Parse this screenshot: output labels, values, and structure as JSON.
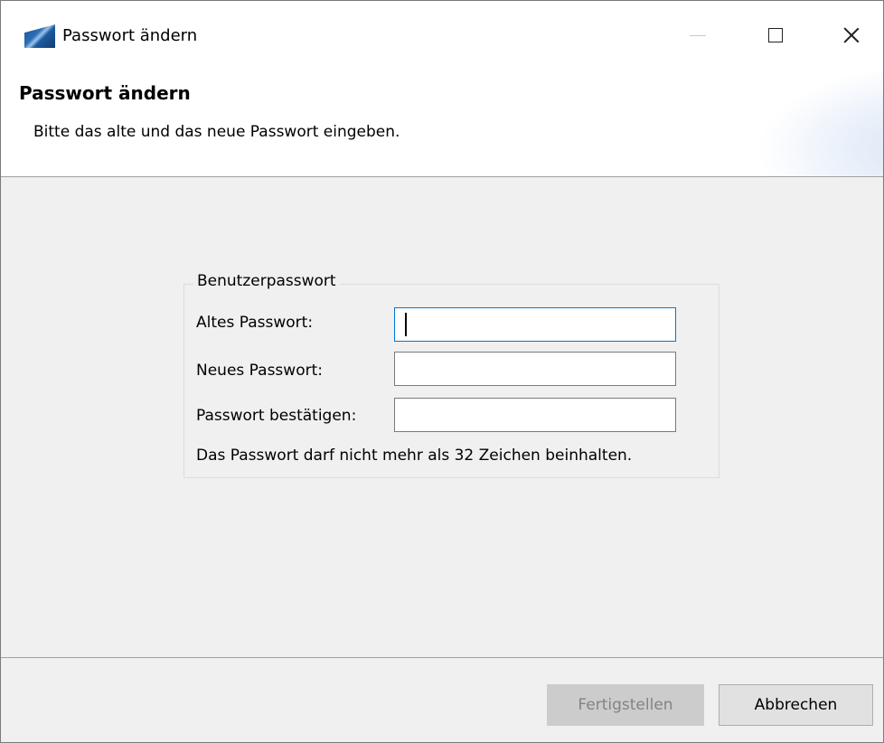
{
  "window": {
    "title": "Passwort ändern"
  },
  "header": {
    "title": "Passwort ändern",
    "description": "Bitte das alte und das neue Passwort eingeben."
  },
  "group": {
    "legend": "Benutzerpasswort",
    "fields": [
      {
        "label": "Altes Passwort:",
        "value": "",
        "focused": true
      },
      {
        "label": "Neues Passwort:",
        "value": ""
      },
      {
        "label": "Passwort bestätigen:",
        "value": ""
      }
    ],
    "hint": "Das Passwort darf nicht mehr als 32 Zeichen beinhalten."
  },
  "buttons": {
    "finish": "Fertigstellen",
    "finish_enabled": false,
    "cancel": "Abbrechen"
  },
  "icons": {
    "app": "app-logo-icon",
    "minimize": "minimize-icon",
    "maximize": "maximize-icon",
    "close": "close-icon"
  },
  "colors": {
    "focus_border": "#0078d7",
    "disabled_button_bg": "#cccccc",
    "disabled_button_text": "#838383"
  }
}
